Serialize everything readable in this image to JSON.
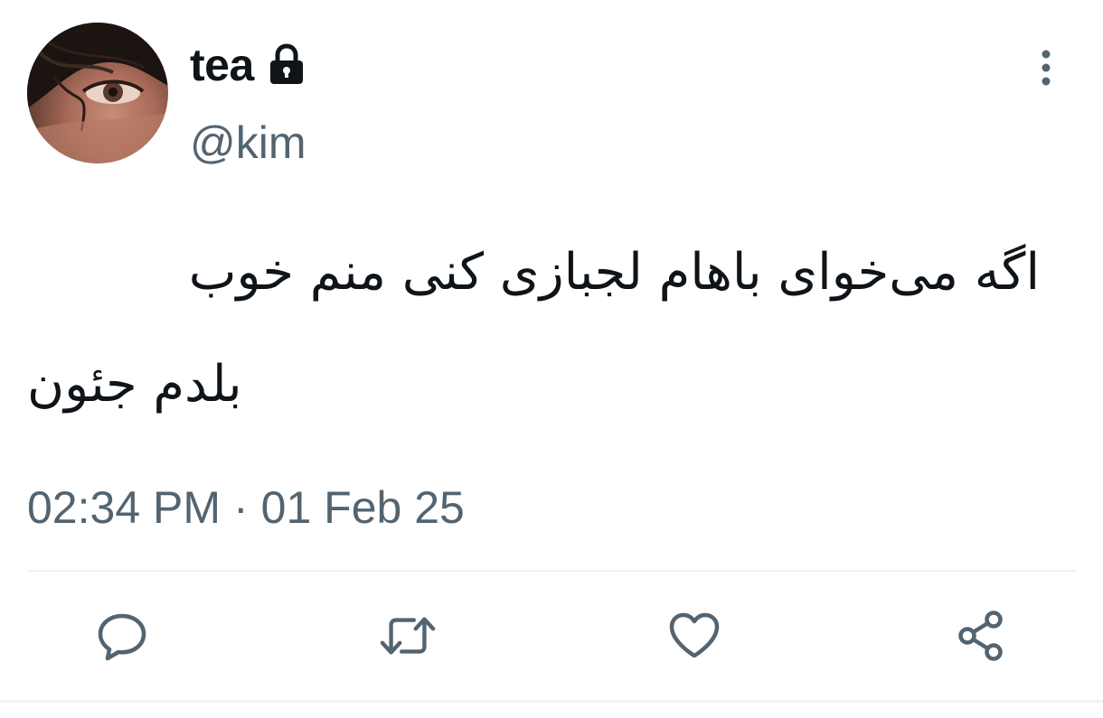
{
  "author": {
    "display_name": "tea",
    "handle": "@kim",
    "protected": true,
    "avatar_icon": "avatar-eye-photo",
    "lock_icon": "lock-icon"
  },
  "tweet": {
    "text_line_1": "اگه می‌خوای باهام لجبازی کنی منم خوب",
    "text_line_2": "بلدم جئون",
    "time": "02:34 PM",
    "separator": "·",
    "date": "01 Feb 25"
  },
  "actions": [
    {
      "name": "reply",
      "icon": "comment-bubble-icon"
    },
    {
      "name": "retweet",
      "icon": "retweet-arrows-icon"
    },
    {
      "name": "like",
      "icon": "heart-icon"
    },
    {
      "name": "share",
      "icon": "share-nodes-icon"
    }
  ],
  "more_menu_icon": "vertical-ellipsis-icon",
  "colors": {
    "primary_text": "#0f1419",
    "secondary_text": "#536471",
    "divider": "#eff3f4",
    "action_icon": "#536471"
  }
}
